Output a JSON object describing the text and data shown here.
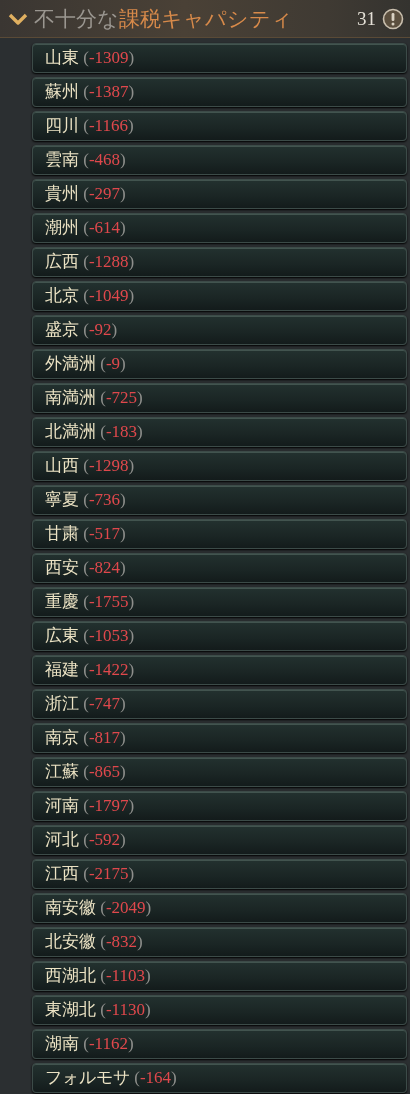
{
  "header": {
    "title": "不十分な**課税キャパシティ**",
    "count": "31",
    "expanded": true
  },
  "rows": [
    {
      "text": "**山東** (*-1309*)"
    },
    {
      "text": "**蘇州** (*-1387*)"
    },
    {
      "text": "**四川** (*-1166*)"
    },
    {
      "text": "**雲南** (*-468*)"
    },
    {
      "text": "**貴州** (*-297*)"
    },
    {
      "text": "**潮州** (*-614*)"
    },
    {
      "text": "**広西** (*-1288*)"
    },
    {
      "text": "**北京** (*-1049*)"
    },
    {
      "text": "**盛京** (*-92*)"
    },
    {
      "text": "**外満洲** (*-9*)"
    },
    {
      "text": "**南満洲** (*-725*)"
    },
    {
      "text": "**北満洲** (*-183*)"
    },
    {
      "text": "**山西** (*-1298*)"
    },
    {
      "text": "**寧夏** (*-736*)"
    },
    {
      "text": "**甘粛** (*-517*)"
    },
    {
      "text": "**西安** (*-824*)"
    },
    {
      "text": "**重慶** (*-1755*)"
    },
    {
      "text": "**広東** (*-1053*)"
    },
    {
      "text": "**福建** (*-1422*)"
    },
    {
      "text": "**浙江** (*-747*)"
    },
    {
      "text": "**南京** (*-817*)"
    },
    {
      "text": "**江蘇** (*-865*)"
    },
    {
      "text": "**河南** (*-1797*)"
    },
    {
      "text": "**河北** (*-592*)"
    },
    {
      "text": "**江西** (*-2175*)"
    },
    {
      "text": "**南安徽** (*-2049*)"
    },
    {
      "text": "**北安徽** (*-832*)"
    },
    {
      "text": "**西湖北** (*-1103*)"
    },
    {
      "text": "**東湖北** (*-1130*)"
    },
    {
      "text": "**湖南** (*-1162*)"
    },
    {
      "text": "**フォルモサ** (*-164*)"
    }
  ]
}
